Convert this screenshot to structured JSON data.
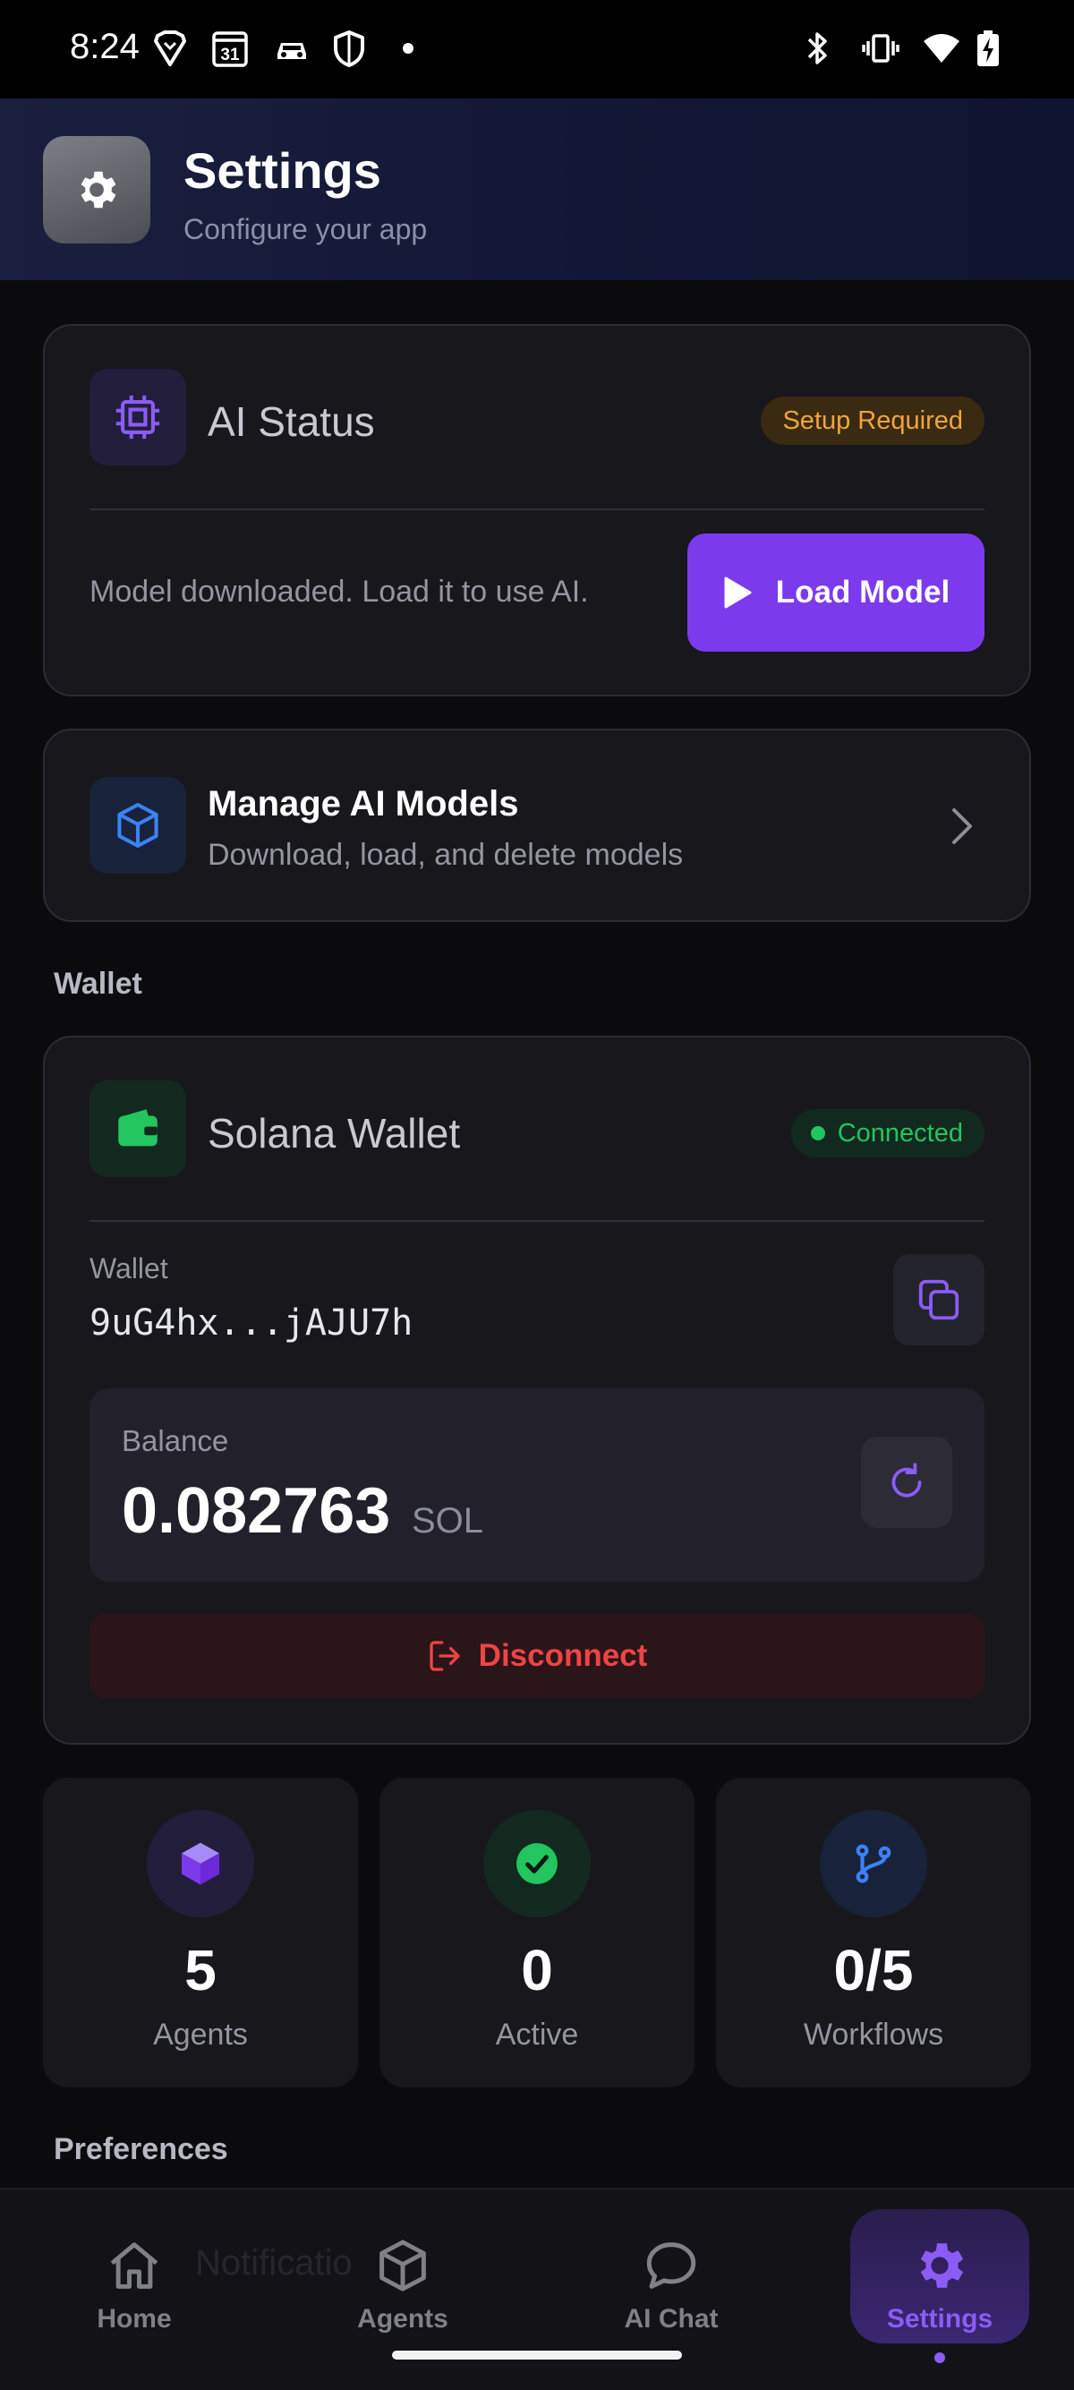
{
  "status_bar": {
    "time": "8:24",
    "calendar_day": "31"
  },
  "header": {
    "title": "Settings",
    "subtitle": "Configure your app"
  },
  "ai_status": {
    "title": "AI Status",
    "badge": "Setup Required",
    "description": "Model downloaded. Load it to use AI.",
    "button_label": "Load Model"
  },
  "manage_models": {
    "title": "Manage AI Models",
    "subtitle": "Download, load, and delete models"
  },
  "sections": {
    "wallet": "Wallet",
    "preferences": "Preferences"
  },
  "wallet": {
    "title": "Solana Wallet",
    "badge": "Connected",
    "address_label": "Wallet",
    "address": "9uG4hx...jAJU7h",
    "balance_label": "Balance",
    "balance_value": "0.082763",
    "balance_unit": "SOL",
    "disconnect_label": "Disconnect"
  },
  "stats": [
    {
      "value": "5",
      "label": "Agents",
      "icon": "cube-icon"
    },
    {
      "value": "0",
      "label": "Active",
      "icon": "check-circle-icon"
    },
    {
      "value": "0/5",
      "label": "Workflows",
      "icon": "git-branch-icon"
    }
  ],
  "nav": {
    "ghost_text": "Notificatio",
    "items": [
      {
        "label": "Home",
        "icon": "home-icon"
      },
      {
        "label": "Agents",
        "icon": "cube-icon"
      },
      {
        "label": "AI Chat",
        "icon": "chat-icon"
      },
      {
        "label": "Settings",
        "icon": "gear-icon",
        "active": true
      }
    ]
  },
  "colors": {
    "accent": "#7c3aed",
    "accent_light": "#8b5cf6",
    "success": "#22c55e",
    "warning": "#f0a53a",
    "danger": "#ef4444",
    "info": "#3b82f6",
    "background": "#0b0b0e",
    "card": "#17171c"
  }
}
